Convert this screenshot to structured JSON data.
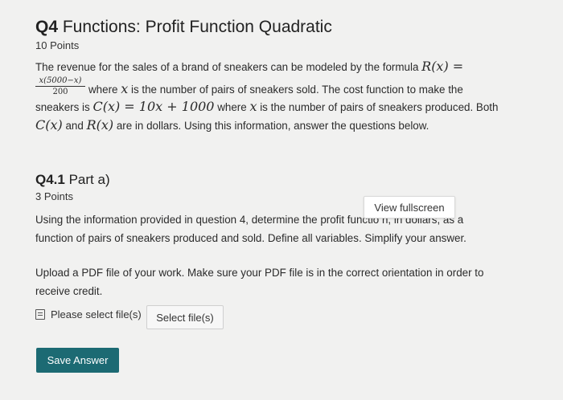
{
  "question": {
    "number": "Q4",
    "title": "Functions: Profit Function Quadratic",
    "points": "10 Points",
    "para_line1": "The revenue for the sales of a brand of sneakers can be modeled by the formula",
    "revenue_lhs": "R(x) =",
    "fraction_numerator": "x(5000−x)",
    "fraction_denominator": "200",
    "para_line2a": "where",
    "var_x": "x",
    "para_line2b": "is the number of pairs of sneakers sold. The cost function to make the",
    "para_line3a": "sneakers is",
    "cost_formula": "C(x) = 10x + 1000",
    "para_line3b": "where",
    "para_line3c": "is the number of pairs of sneakers produced. Both",
    "cost_fn": "C(x)",
    "and_text": "and",
    "rev_fn": "R(x)",
    "para_line4": "are in dollars. Using this information, answer the questions below."
  },
  "part": {
    "number": "Q4.1",
    "title": "Part a)",
    "points": "3 Points",
    "tooltip": "View fullscreen",
    "line1": "Using the information provided in question 4, determine the profit functio n, in dollars, as a",
    "line2": "function of pairs of sneakers produced and sold. Define all variables. Simplify your answer.",
    "upload_line1": "Upload a PDF file of your work. Make sure your PDF file is in the correct orientation in order to",
    "upload_line2": "receive credit.",
    "file_label": "Please select file(s)",
    "select_button": "Select file(s)",
    "save_button": "Save Answer"
  }
}
